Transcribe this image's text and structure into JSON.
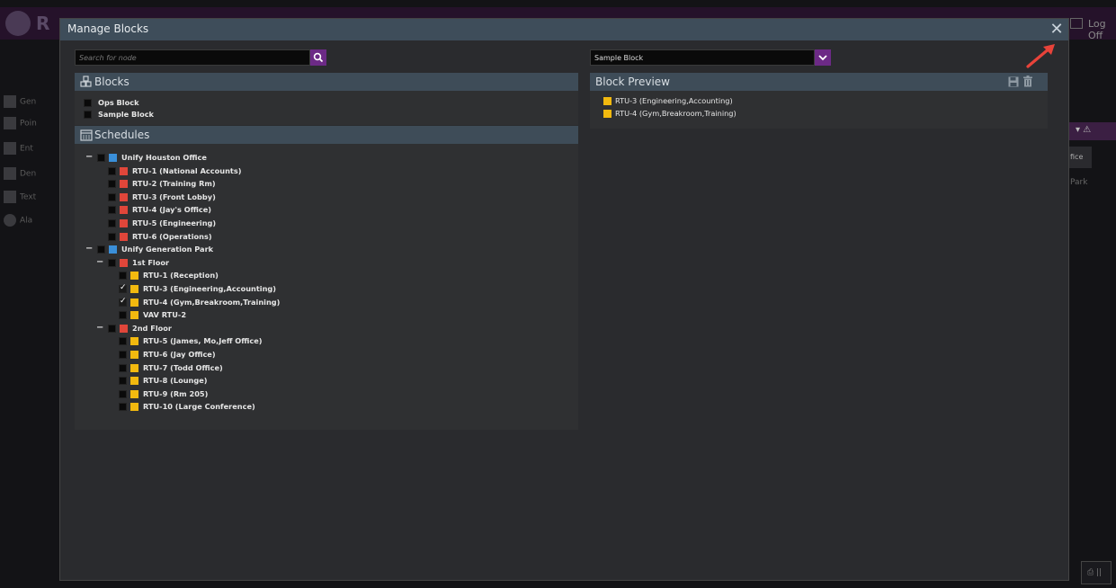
{
  "background": {
    "brand": "R",
    "logoff": "Log Off",
    "sidebar": [
      "Gen",
      "Poin",
      "Ent",
      "Den",
      "Text",
      "Ala"
    ],
    "office_tab": "fice",
    "park_text": "Park"
  },
  "modal": {
    "title": "Manage Blocks",
    "close_glyph": "✕"
  },
  "search": {
    "placeholder": "Search for node"
  },
  "blocks": {
    "title": "Blocks",
    "items": [
      "Ops Block",
      "Sample Block"
    ]
  },
  "schedules": {
    "title": "Schedules",
    "tree": [
      {
        "level": 0,
        "label": "Unify Houston Office",
        "color": "#3a8fd9",
        "collapse": "−",
        "checked": false
      },
      {
        "level": 1,
        "label": "RTU-1 (National Accounts)",
        "color": "#e0463a",
        "checked": false
      },
      {
        "level": 1,
        "label": "RTU-2 (Training Rm)",
        "color": "#e0463a",
        "checked": false
      },
      {
        "level": 1,
        "label": "RTU-3 (Front Lobby)",
        "color": "#e0463a",
        "checked": false
      },
      {
        "level": 1,
        "label": "RTU-4 (Jay's Office)",
        "color": "#e0463a",
        "checked": false
      },
      {
        "level": 1,
        "label": "RTU-5 (Engineering)",
        "color": "#e0463a",
        "checked": false
      },
      {
        "level": 1,
        "label": "RTU-6 (Operations)",
        "color": "#e0463a",
        "checked": false
      },
      {
        "level": 0,
        "label": "Unify Generation Park",
        "color": "#3a8fd9",
        "collapse": "−",
        "checked": false
      },
      {
        "level": 1,
        "label": "1st Floor",
        "color": "#e0463a",
        "collapse": "−",
        "checked": false
      },
      {
        "level": 2,
        "label": "RTU-1 (Reception)",
        "color": "#f2b90f",
        "checked": false
      },
      {
        "level": 2,
        "label": "RTU-3 (Engineering,Accounting)",
        "color": "#f2b90f",
        "checked": true
      },
      {
        "level": 2,
        "label": "RTU-4 (Gym,Breakroom,Training)",
        "color": "#f2b90f",
        "checked": true
      },
      {
        "level": 2,
        "label": "VAV RTU-2",
        "color": "#f2b90f",
        "checked": false
      },
      {
        "level": 1,
        "label": "2nd Floor",
        "color": "#e0463a",
        "collapse": "−",
        "checked": false
      },
      {
        "level": 2,
        "label": "RTU-5 (James, Mo,Jeff Office)",
        "color": "#f2b90f",
        "checked": false
      },
      {
        "level": 2,
        "label": "RTU-6 (Jay Office)",
        "color": "#f2b90f",
        "checked": false
      },
      {
        "level": 2,
        "label": "RTU-7 (Todd Office)",
        "color": "#f2b90f",
        "checked": false
      },
      {
        "level": 2,
        "label": "RTU-8 (Lounge)",
        "color": "#f2b90f",
        "checked": false
      },
      {
        "level": 2,
        "label": "RTU-9 (Rm 205)",
        "color": "#f2b90f",
        "checked": false
      },
      {
        "level": 2,
        "label": "RTU-10 (Large Conference)",
        "color": "#f2b90f",
        "checked": false
      }
    ]
  },
  "block_select": {
    "value": "Sample Block"
  },
  "preview": {
    "title": "Block Preview",
    "items": [
      {
        "label": "RTU-3 (Engineering,Accounting)",
        "color": "#f2b90f"
      },
      {
        "label": "RTU-4 (Gym,Breakroom,Training)",
        "color": "#f2b90f"
      }
    ]
  },
  "colors": {
    "accent": "#6c2a86",
    "header": "#3e4d5a",
    "arrow": "#e8433a"
  }
}
